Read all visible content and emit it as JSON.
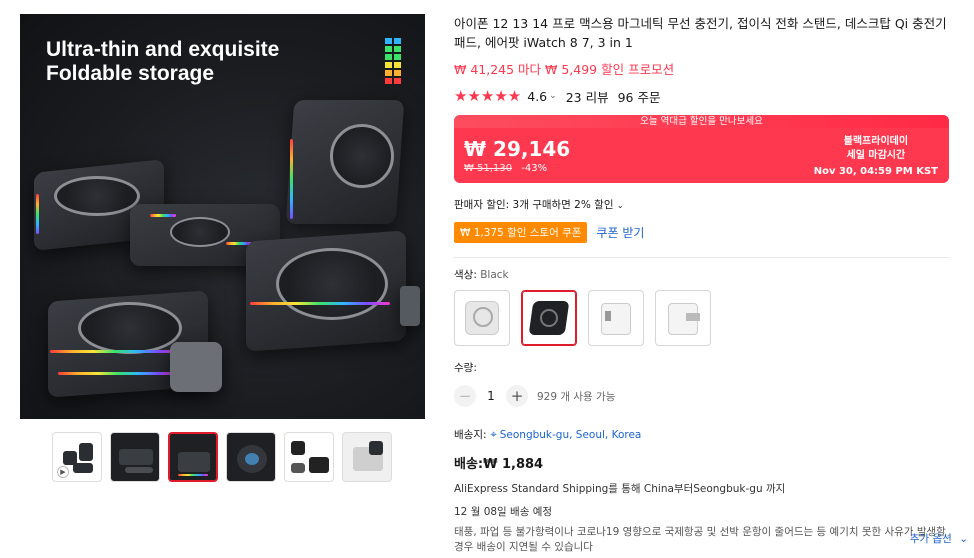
{
  "hero": {
    "title_line1": "Ultra-thin and exquisite",
    "title_line2": "Foldable storage"
  },
  "gallery": {
    "thumb_count": 6,
    "selected_index": 2
  },
  "product": {
    "title": "아이폰 12 13 14 프로 맥스용 마그네틱 무선 충전기, 접이식 전화 스탠드, 데스크탑 Qi 충전기 패드, 에어팟 iWatch 8 7, 3 in 1",
    "promo": "₩ 41,245 마다 ₩ 5,499 할인 프로모션",
    "rating": "4.6",
    "reviews": "23 리뷰",
    "orders": "96 주문"
  },
  "price": {
    "banner": "오늘 역대급 할인을 만나보세요",
    "current": "₩ 29,146",
    "original": "₩ 51,130",
    "discount": "-43%",
    "event_line1": "블랙프라이데이",
    "event_line2": "세일 마감시간",
    "event_date": "Nov 30, 04:59 PM KST"
  },
  "discounts": {
    "seller": "판매자 할인: 3개 구매하면 2% 할인",
    "coupon": "₩ 1,375 할인 스토어 쿠폰",
    "coupon_action": "쿠폰 받기"
  },
  "color": {
    "label": "색상:",
    "value": "Black",
    "options": [
      "White",
      "Black",
      "Adapter-EU",
      "Adapter-White"
    ],
    "selected_index": 1
  },
  "quantity": {
    "label": "수량:",
    "value": "1",
    "available": "929 개 사용 가능"
  },
  "shipping": {
    "to_label": "배송지:",
    "location": "Seongbuk-gu, Seoul, Korea",
    "cost": "배송:₩ 1,884",
    "method": "AliExpress Standard Shipping를 통해 China부터Seongbuk-gu 까지",
    "eta": "12 월 08일 배송 예정",
    "notice": "태풍, 파업 등 불가항력이나 코로나19 영향으로 국제항공 및 선박 운항이 줄어드는 등 예기치 못한 사유가 발생할 경우 배송이 지연될 수 있습니다",
    "more_options": "추가 옵션"
  },
  "colors": {
    "accent_red": "#fd384f",
    "coupon_orange": "#ff8a00",
    "link_blue": "#1b63d1"
  }
}
